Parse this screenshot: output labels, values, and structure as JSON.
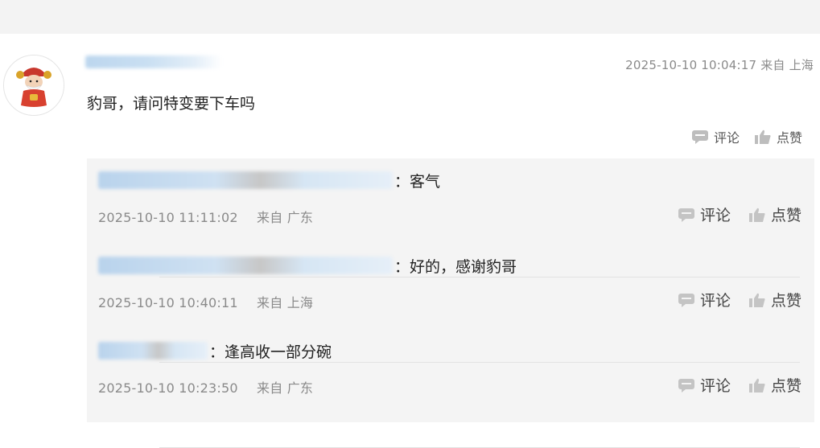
{
  "comment": {
    "text": "豹哥，请问特变要下车吗",
    "timestamp": "2025-10-10 10:04:17 来自 上海",
    "actions": {
      "comment_label": "评论",
      "like_label": "点赞"
    }
  },
  "replies": [
    {
      "text": "：客气",
      "time": "2025-10-10 11:11:02",
      "location": "来自 广东",
      "comment_label": "评论",
      "like_label": "点赞"
    },
    {
      "text": "：好的，感谢豹哥",
      "time": "2025-10-10 10:40:11",
      "location": "来自 上海",
      "comment_label": "评论",
      "like_label": "点赞"
    },
    {
      "text": "：逢高收一部分碗",
      "time": "2025-10-10 10:23:50",
      "location": "来自 广东",
      "comment_label": "评论",
      "like_label": "点赞"
    }
  ],
  "icons": {
    "comment": "comment-bubble-icon",
    "like": "thumbs-up-icon"
  },
  "colors": {
    "link_blue": "#b9d3ec",
    "reply_background": "#f4f4f4",
    "muted_text": "#8a8a8a"
  }
}
